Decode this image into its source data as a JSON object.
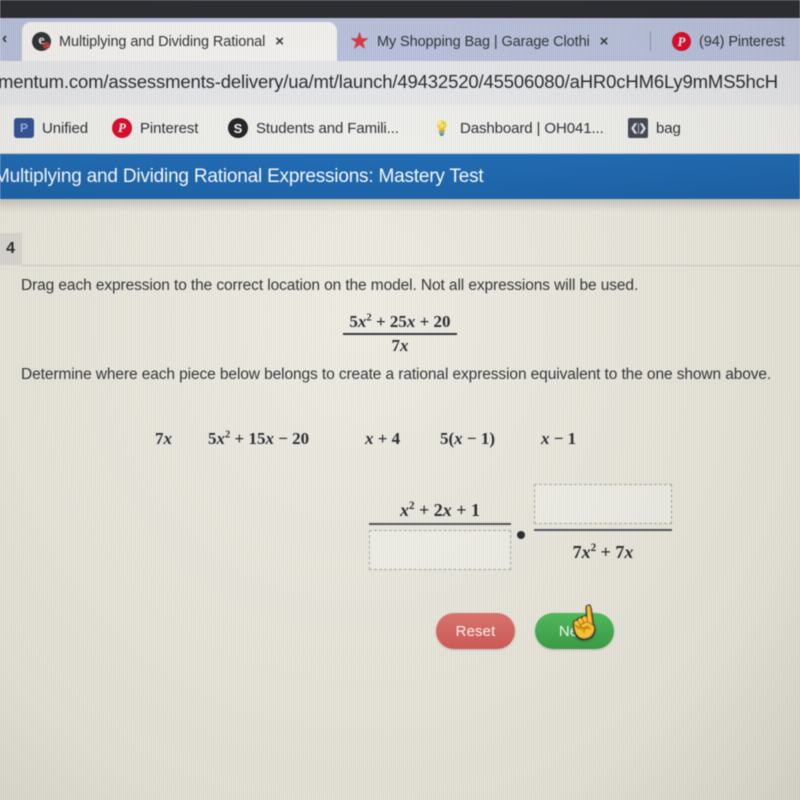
{
  "browser": {
    "scroll_left_caret": "‹",
    "tabs": [
      {
        "favicon": "edu-e-icon",
        "title": "Multiplying and Dividing Rational",
        "close": "×",
        "active": true
      },
      {
        "favicon": "star-icon",
        "title": "My Shopping Bag | Garage Clothi",
        "close": "×",
        "active": false
      },
      {
        "favicon": "pinterest-icon",
        "title": "(94) Pinterest",
        "close": "",
        "active": false
      }
    ],
    "url": "mentum.com/assessments-delivery/ua/mt/launch/49432520/45506080/aHR0cHM6Ly9mMS5hcH",
    "bookmarks": [
      {
        "icon": "unified-icon",
        "label": "Unified"
      },
      {
        "icon": "pinterest-icon",
        "label": "Pinterest"
      },
      {
        "icon": "students-icon",
        "label": "Students and Famili..."
      },
      {
        "icon": "dashboard-icon",
        "label": "Dashboard | OH041..."
      },
      {
        "icon": "bag-icon",
        "label": "bag"
      }
    ]
  },
  "app": {
    "header_title": "Multiplying and Dividing Rational Expressions: Mastery Test",
    "header_color": "#1266b8"
  },
  "question": {
    "number": "4",
    "instruction_1": "Drag each expression to the correct location on the model. Not all expressions will be used.",
    "instruction_2": "Determine where each piece below belongs to create a rational expression equivalent to the one shown above.",
    "given_expression": {
      "numerator_html": "5<i>x</i><sup>2</sup> + 25<i>x</i> + 20",
      "denominator_html": "7<i>x</i>"
    },
    "tiles": [
      {
        "id": "tile-1",
        "html": "7<i>x</i>"
      },
      {
        "id": "tile-2",
        "html": "5<i>x</i><sup>2</sup> + 15<i>x</i> &minus; 20"
      },
      {
        "id": "tile-3",
        "html": "<i>x</i> + 4"
      },
      {
        "id": "tile-4",
        "html": "5(<i>x</i> &minus; 1)"
      },
      {
        "id": "tile-5",
        "html": "<i>x</i> &minus; 1"
      }
    ],
    "model": {
      "operator": "multiplication-dot",
      "left_fraction": {
        "numerator_html": "<i>x</i><sup>2</sup> + 2<i>x</i> + 1",
        "denominator_html": "",
        "denominator_is_dropzone": true
      },
      "right_fraction": {
        "numerator_html": "",
        "numerator_is_dropzone": true,
        "denominator_html": "7<i>x</i><sup>2</sup> + 7<i>x</i>"
      }
    },
    "buttons": {
      "reset": {
        "label": "Reset",
        "color": "#e0625e"
      },
      "next": {
        "label": "Next",
        "color": "#3ab24a"
      }
    }
  },
  "cursor": {
    "type": "pointing-hand",
    "glyph": "☝"
  }
}
